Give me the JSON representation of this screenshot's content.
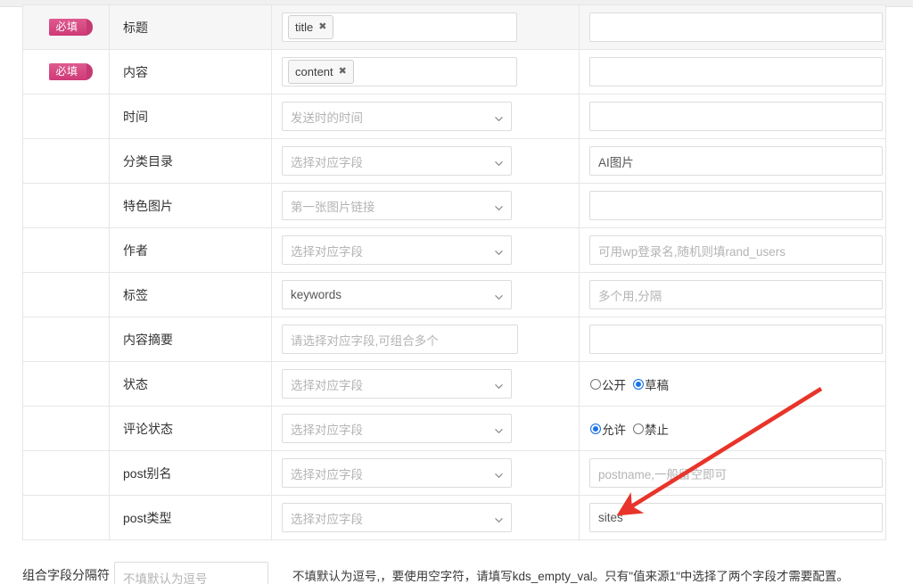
{
  "badge": {
    "required_label": "必填"
  },
  "icons": {
    "chevron": "chevron-down-icon",
    "chip_close": "✖"
  },
  "colors": {
    "badge_pink": "#d4447e",
    "badge_pink_tail": "#c43a72",
    "radio_blue": "#1a73e8",
    "annotation_red": "#e8342a",
    "border_gray": "#e6e6e6",
    "placeholder_gray": "#b4b4b4"
  },
  "table": {
    "rows": [
      {
        "required": true,
        "label": "标题",
        "source": {
          "kind": "tagbox",
          "chips": [
            {
              "text": "title",
              "close": "✖"
            }
          ]
        },
        "value": {
          "kind": "input",
          "text": "",
          "placeholder": ""
        }
      },
      {
        "required": true,
        "label": "内容",
        "source": {
          "kind": "tagbox",
          "chips": [
            {
              "text": "content",
              "close": "✖"
            }
          ]
        },
        "value": {
          "kind": "input",
          "text": "",
          "placeholder": ""
        }
      },
      {
        "required": false,
        "label": "时间",
        "source": {
          "kind": "select",
          "text": "发送时的时间",
          "is_placeholder": true
        },
        "value": {
          "kind": "input",
          "text": "",
          "placeholder": ""
        }
      },
      {
        "required": false,
        "label": "分类目录",
        "source": {
          "kind": "select",
          "text": "选择对应字段",
          "is_placeholder": true
        },
        "value": {
          "kind": "input",
          "text": "AI图片",
          "placeholder": ""
        }
      },
      {
        "required": false,
        "label": "特色图片",
        "source": {
          "kind": "select",
          "text": "第一张图片链接",
          "is_placeholder": true
        },
        "value": {
          "kind": "input",
          "text": "",
          "placeholder": ""
        }
      },
      {
        "required": false,
        "label": "作者",
        "source": {
          "kind": "select",
          "text": "选择对应字段",
          "is_placeholder": true
        },
        "value": {
          "kind": "input",
          "text": "",
          "placeholder": "可用wp登录名,随机则填rand_users"
        }
      },
      {
        "required": false,
        "label": "标签",
        "source": {
          "kind": "select",
          "text": "keywords",
          "is_placeholder": false
        },
        "value": {
          "kind": "input",
          "text": "",
          "placeholder": "多个用,分隔"
        }
      },
      {
        "required": false,
        "label": "内容摘要",
        "source": {
          "kind": "textinput",
          "text": "",
          "placeholder": "请选择对应字段,可组合多个"
        },
        "value": {
          "kind": "input",
          "text": "",
          "placeholder": ""
        }
      },
      {
        "required": false,
        "label": "状态",
        "source": {
          "kind": "select",
          "text": "选择对应字段",
          "is_placeholder": true
        },
        "value": {
          "kind": "radios",
          "options": [
            {
              "label": "公开",
              "checked": false
            },
            {
              "label": "草稿",
              "checked": true
            }
          ]
        }
      },
      {
        "required": false,
        "label": "评论状态",
        "source": {
          "kind": "select",
          "text": "选择对应字段",
          "is_placeholder": true
        },
        "value": {
          "kind": "radios",
          "options": [
            {
              "label": "允许",
              "checked": true
            },
            {
              "label": "禁止",
              "checked": false
            }
          ]
        }
      },
      {
        "required": false,
        "label": "post别名",
        "source": {
          "kind": "select",
          "text": "选择对应字段",
          "is_placeholder": true
        },
        "value": {
          "kind": "input",
          "text": "",
          "placeholder": "postname,一般留空即可"
        }
      },
      {
        "required": false,
        "label": "post类型",
        "source": {
          "kind": "select",
          "text": "选择对应字段",
          "is_placeholder": true
        },
        "value": {
          "kind": "input",
          "text": "sites",
          "placeholder": ""
        }
      }
    ]
  },
  "bottom": {
    "label": "组合字段分隔符",
    "input_placeholder": "不填默认为逗号",
    "note": "不填默认为逗号,，要使用空字符，请填写kds_empty_val。只有\"值来源1\"中选择了两个字段才需要配置。"
  }
}
